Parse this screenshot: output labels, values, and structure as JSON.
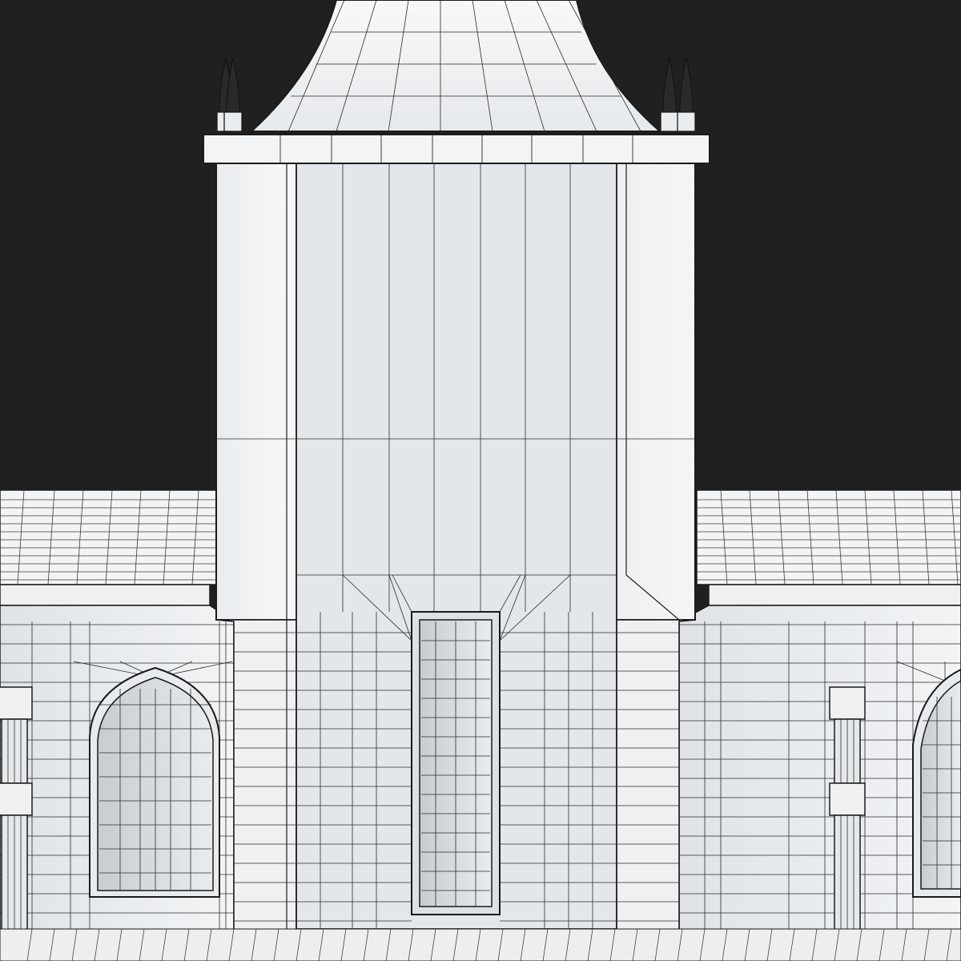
{
  "scene": {
    "subject": "wireframe-render",
    "colors": {
      "background": "#202020",
      "surface": "#f1f3f5",
      "surface_shade": "#d9dde1",
      "surface_dark": "#b8bec4",
      "wire": "#1a1a1a",
      "finial": "#2a2a2a"
    },
    "icons": [
      "spire-roof",
      "tower",
      "finial",
      "gothic-window",
      "slit-window",
      "buttress",
      "tiled-roof"
    ]
  }
}
